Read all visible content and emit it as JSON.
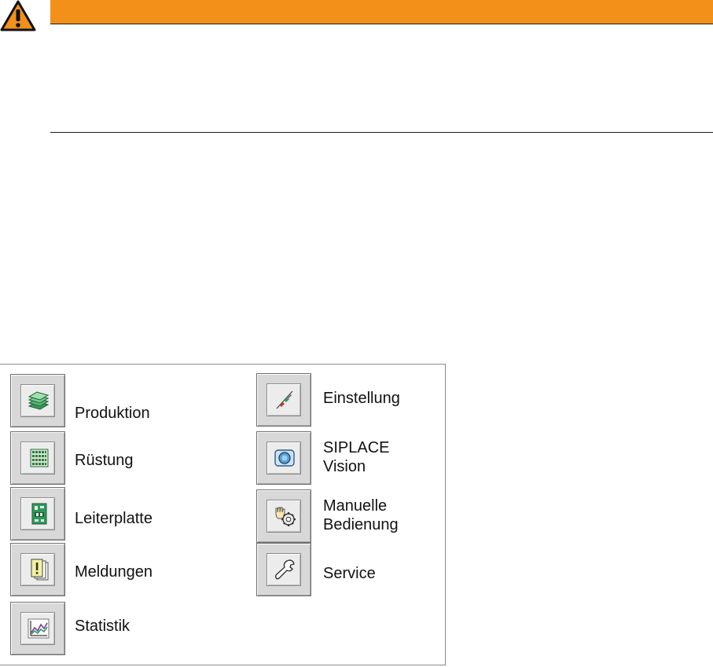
{
  "menu": {
    "left": [
      {
        "label": "Produktion",
        "icon": "stack-icon"
      },
      {
        "label": "Rüstung",
        "icon": "feeder-grid-icon"
      },
      {
        "label": "Leiterplatte",
        "icon": "circuit-board-icon"
      },
      {
        "label": "Meldungen",
        "icon": "message-icon"
      },
      {
        "label": "Statistik",
        "icon": "chart-icon"
      }
    ],
    "right": [
      {
        "label": "Einstellung",
        "icon": "adjust-icon"
      },
      {
        "label_line1": "SIPLACE",
        "label_line2": "Vision",
        "icon": "camera-icon"
      },
      {
        "label_line1": "Manuelle",
        "label_line2": "Bedienung",
        "icon": "hand-gear-icon"
      },
      {
        "label": "Service",
        "icon": "wrench-icon"
      }
    ]
  },
  "colors": {
    "warning_bar": "#f39019",
    "warning_icon_fill": "#f39019"
  }
}
